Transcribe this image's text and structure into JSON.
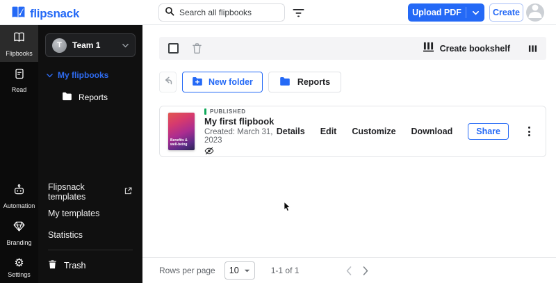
{
  "brand": {
    "name": "flipsnack",
    "accent_color": "#2469f6"
  },
  "topbar": {
    "search": {
      "placeholder": "Search all flipbooks"
    },
    "upload_pdf_label": "Upload PDF",
    "create_label": "Create"
  },
  "rail": {
    "items": [
      {
        "label": "Flipbooks",
        "icon": "flipbooks-icon",
        "active": true
      },
      {
        "label": "Read",
        "icon": "read-icon",
        "active": false
      },
      {
        "label": "Automation",
        "icon": "automation-icon",
        "active": false
      },
      {
        "label": "Branding",
        "icon": "branding-icon",
        "active": false
      },
      {
        "label": "Settings",
        "icon": "settings-icon",
        "active": false
      }
    ]
  },
  "sidebar": {
    "team_name": "Team 1",
    "team_initial": "T",
    "my_flipbooks_label": "My flipbooks",
    "folder_label": "Reports",
    "templates_link": "Flipsnack templates",
    "my_templates_link": "My templates",
    "statistics_link": "Statistics",
    "trash_label": "Trash"
  },
  "toolbar": {
    "create_bookshelf_label": "Create bookshelf"
  },
  "folder_bar": {
    "new_folder_label": "New folder",
    "reports_label": "Reports"
  },
  "card": {
    "status": "PUBLISHED",
    "title": "My first flipbook",
    "created": "Created: March 31, 2023",
    "cover_text": "Benefits & well-being",
    "actions": [
      "Details",
      "Edit",
      "Customize",
      "Download"
    ],
    "share_label": "Share",
    "status_color": "#10a95b"
  },
  "footer": {
    "rows_per_page_label": "Rows per page",
    "rows_value": "10",
    "range_label": "1-1 of 1"
  }
}
